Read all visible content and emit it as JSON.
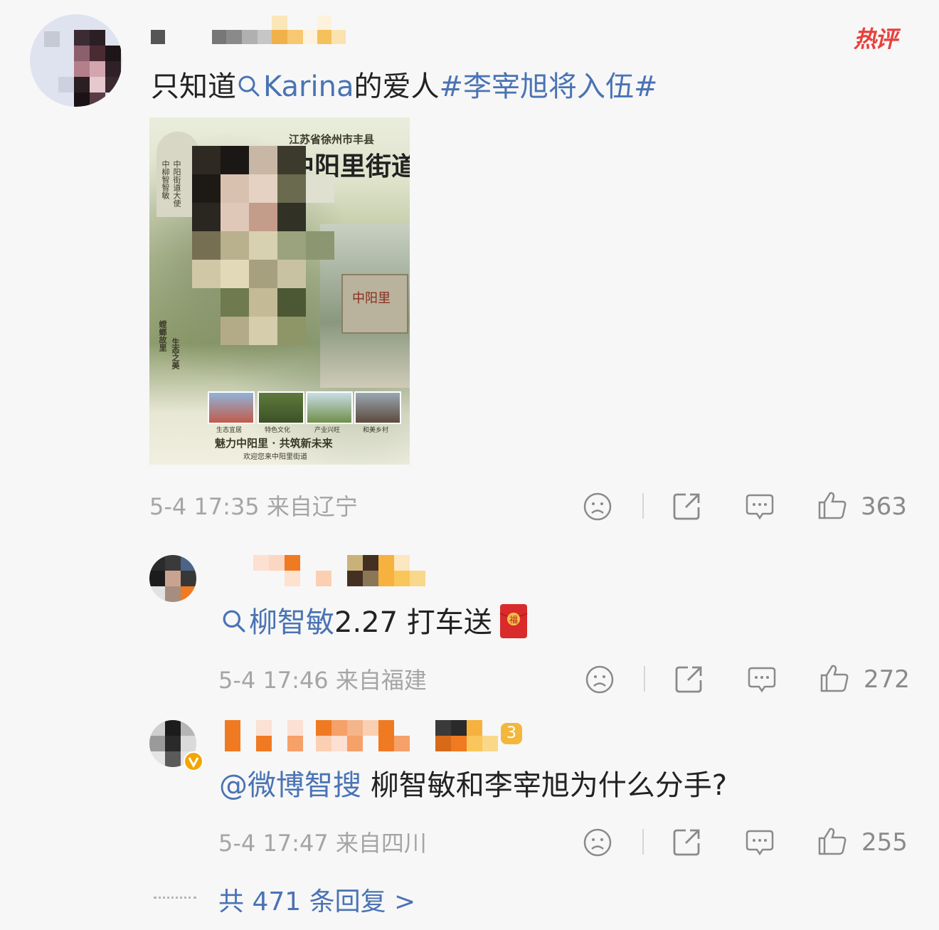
{
  "hot_badge": "热评",
  "comments": [
    {
      "text_prefix": "只知道",
      "search_keyword": "Karina",
      "text_mid": "的爱人",
      "hashtag": "#李宰旭将入伍#",
      "timestamp": "5-4 17:35",
      "location": "来自辽宁",
      "likes": "363"
    },
    {
      "search_keyword": "柳智敏",
      "text_suffix": "2.27 打车送",
      "timestamp": "5-4 17:46",
      "location": "来自福建",
      "likes": "272"
    },
    {
      "mention": "@微博智搜",
      "text_suffix": "柳智敏和李宰旭为什么分手?",
      "timestamp": "5-4 17:47",
      "location": "来自四川",
      "likes": "255",
      "level_badge": "3"
    }
  ],
  "poster": {
    "top_line": "江苏省徐州市丰县",
    "title": "中阳里街道",
    "left_vertical_1": "中柳智智敏",
    "left_vertical_2": "中阳街道大使",
    "sign_text": "中阳里",
    "bottom_left_1": "螳螂故里",
    "bottom_left_2": "生态之美",
    "thumb_labels": [
      "生态宜居",
      "特色文化",
      "产业兴旺",
      "和美乡村"
    ],
    "slogan": "魅力中阳里 · 共筑新未来",
    "welcome": "欢迎您来中阳里街道"
  },
  "replies_link": "共 471 条回复 >",
  "icons": [
    "dislike-icon",
    "share-icon",
    "comment-icon",
    "like-icon",
    "search-icon",
    "red-envelope-icon",
    "verified-icon"
  ],
  "colors": {
    "link_blue": "#4a73b4",
    "hot_red": "#e8403c",
    "meta_gray": "#a5a5a5"
  }
}
